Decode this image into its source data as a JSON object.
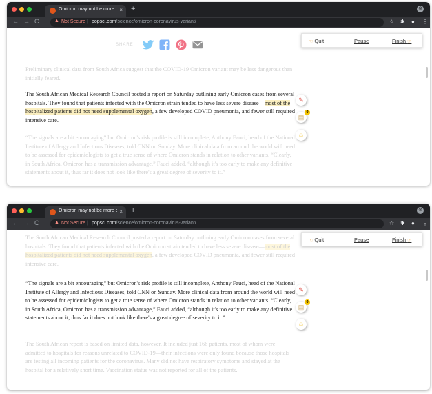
{
  "browser": {
    "tab_title": "Omicron may not be more dan",
    "tab_close": "×",
    "new_tab": "+",
    "back": "←",
    "forward": "→",
    "reload": "C",
    "not_secure": "Not Secure",
    "separator": "|",
    "url_host": "popsci.com",
    "url_path": "/science/omicron-coronavirus-variant/",
    "star_icon": "☆",
    "extensions_icon": "✱",
    "profile_icon": "●",
    "menu_icon": "⋮",
    "window_menu_icon": "⊗"
  },
  "reader_panel": {
    "quit_label": "Quit",
    "pause_label": "Pause",
    "finish_label": "Finish",
    "hand_glyph": "☜",
    "hand_glyph_right": "☞"
  },
  "floating": {
    "pen_icon": "✎",
    "note_icon": "▤",
    "note_badge": "0",
    "emoji_icon": "☺"
  },
  "share": {
    "label": "SHARE"
  },
  "article": {
    "p_prelim": "Preliminary clinical data from South Africa suggest that the COVID-19 Omicron variant may be less dangerous than initially feared.",
    "p_samrc_before": "The South African Medical Research Council posted a report on Saturday outlining early Omicron cases from several hospitals. They found that patients infected with the Omicron strain tended to have less severe disease—",
    "p_samrc_highlight": "most of the hospitalized patients did not need supplemental oxygen",
    "p_samrc_after": ", a few developed COVID pneumonia, and fewer still required intensive care.",
    "p_fauci_1": "“The signals are a bit encouraging” but Omicron's risk profile is still incomplete, Anthony Fauci, head of the National Institute of Allergy and Infectious Diseases, told ",
    "p_fauci_cnn": "CNN",
    "p_fauci_2": " on Sunday. More clinical data from around the world will need to be assessed for epidemiologists to get a true sense of where Omicron stands in relation to other variants. “Clearly, in South Africa, Omicron has a transmission advantage,” Fauci added, “although it's too early to make any definitive statements about it, thus far it does not look like there's a great degree of severity to it.”",
    "p_limited": "The South African report is based on limited data, however. It included just 166 patients, most of whom were admitted to hospitals for reasons unrelated to COVID-19—their infections were only found because those hospitals are testing all incoming patients for the coronavirus. Many did not have respiratory symptoms and stayed at the hospital for a relatively short time. Vaccination status was not reported for all of the patients."
  },
  "colors": {
    "highlight": "#fbefc0",
    "chrome_dark": "#202124",
    "chrome_tab": "#35363a",
    "not_secure": "#f28b82",
    "twitter": "#1da1f2",
    "facebook": "#1877f2",
    "pinterest": "#e60023",
    "email": "#3c3c3c"
  }
}
